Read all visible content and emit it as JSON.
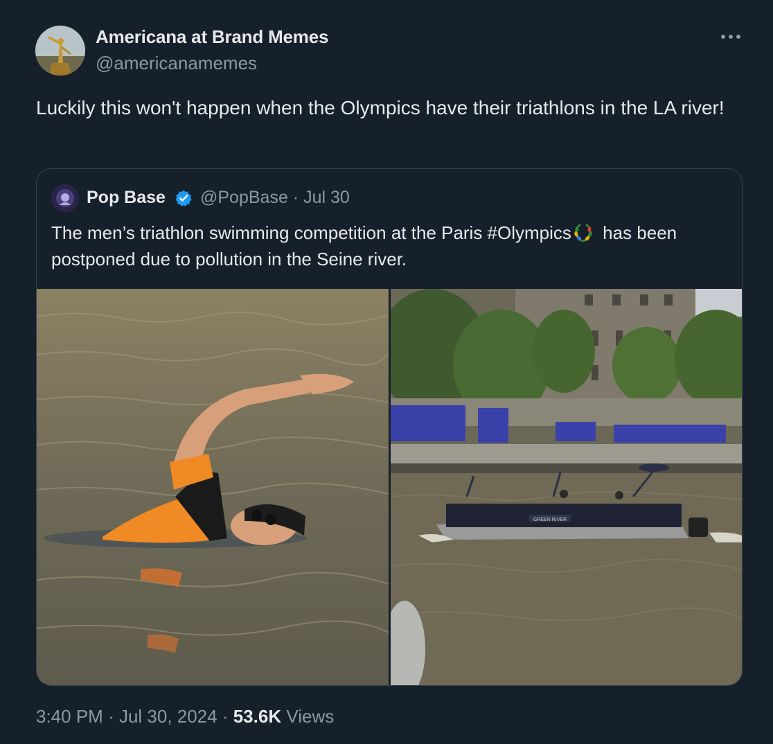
{
  "tweet": {
    "author": {
      "display_name": "Americana at Brand Memes",
      "handle": "@americanamemes"
    },
    "more_icon": "more-horizontal-icon",
    "text": "Luckily this won't happen when the Olympics have their triathlons in the LA river!",
    "quoted": {
      "author": {
        "display_name": "Pop Base",
        "handle": "@PopBase",
        "verified": true,
        "verified_color": "#1d9bf0"
      },
      "date_separator": " · ",
      "date": "Jul 30",
      "text_before_flag": "The men’s triathlon swimming competition at the Paris #Olympics",
      "hashflag_icon": "olympic-laurel-icon",
      "text_after_flag": " has been postponed due to pollution in the Seine river.",
      "media": {
        "boat_label": "GREEN RIVER"
      }
    },
    "footer": {
      "time": "3:40 PM",
      "separator": " · ",
      "date": "Jul 30, 2024",
      "views_count": "53.6K",
      "views_label": "Views"
    }
  },
  "colors": {
    "background": "#15202b",
    "text_primary": "#e7e9ea",
    "text_secondary": "#8b98a5",
    "border": "#38444d",
    "accent": "#1d9bf0"
  }
}
